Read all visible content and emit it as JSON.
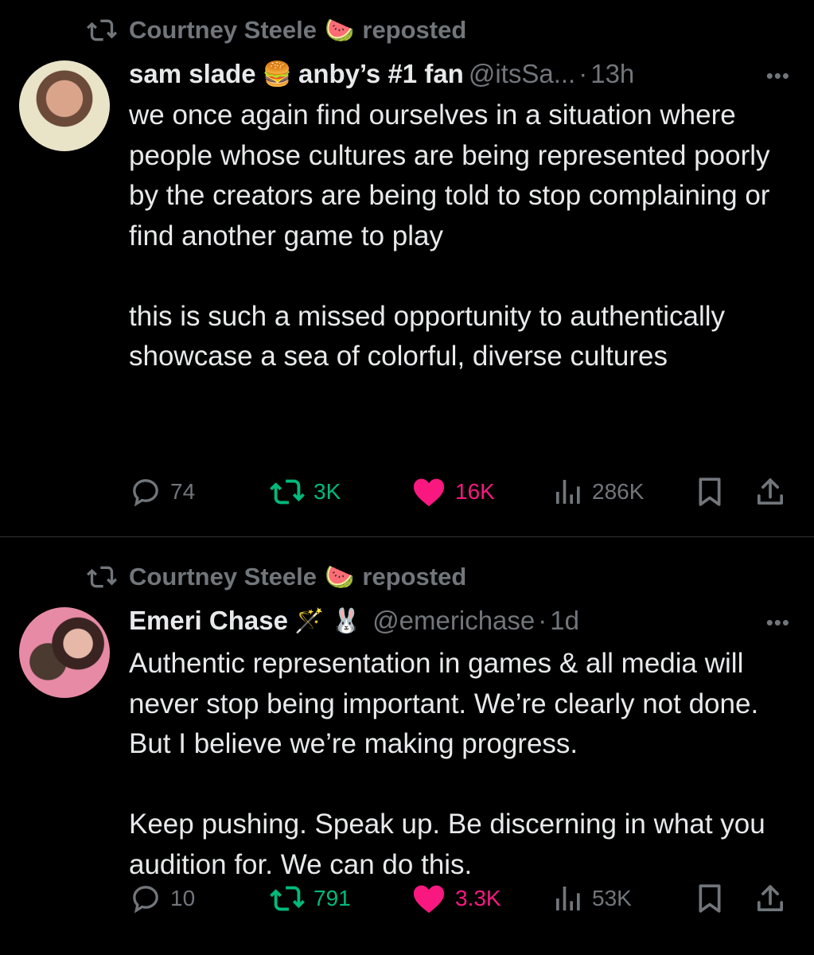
{
  "tweets": [
    {
      "reposted_by": "Courtney Steele",
      "reposted_by_emoji": "🍉",
      "reposted_label": "reposted",
      "display_name": "sam slade",
      "name_emoji": "🍔",
      "name_suffix": "anby’s #1 fan",
      "handle": "@itsSa...",
      "time": "13h",
      "more": "•••",
      "text": "we once again find ourselves in a situation where people whose cultures are being represented poorly by the creators are being told to stop complaining or find another game to play\n\nthis is such a missed opportunity to authentically showcase a sea of colorful, diverse cultures",
      "replies": "74",
      "reposts": "3K",
      "likes": "16K",
      "views": "286K",
      "colors": {
        "repost": "#00ba7c",
        "like": "#f91880"
      }
    },
    {
      "reposted_by": "Courtney Steele",
      "reposted_by_emoji": "🍉",
      "reposted_label": "reposted",
      "display_name": "Emeri Chase",
      "name_emoji": "🪄 🐰",
      "handle": "@emerichase",
      "time": "1d",
      "more": "•••",
      "text": "Authentic representation in games & all media will never stop being important. We’re clearly not done. But I believe we’re making progress.\n\nKeep pushing. Speak up. Be discerning in what you audition for. We can do this.",
      "replies": "10",
      "reposts": "791",
      "likes": "3.3K",
      "views": "53K",
      "colors": {
        "repost": "#00ba7c",
        "like": "#f91880"
      }
    }
  ]
}
